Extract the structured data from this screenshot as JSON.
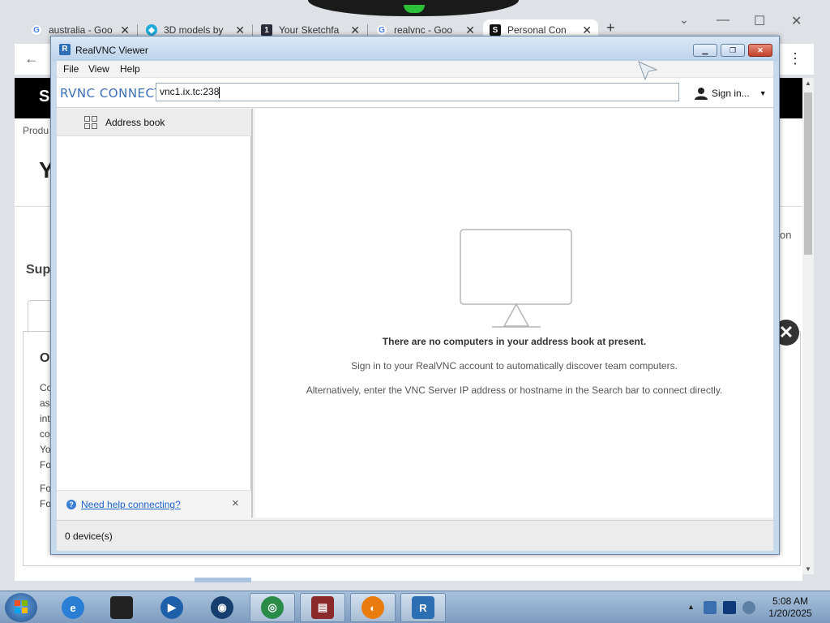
{
  "browser": {
    "tabs": [
      {
        "title": "australia - Goo",
        "icon": "google-icon",
        "active": false
      },
      {
        "title": "3D models by",
        "icon": "sketchfab-icon",
        "active": false
      },
      {
        "title": "Your Sketchfa",
        "icon": "sketchfab-numbered-icon",
        "active": false
      },
      {
        "title": "realvnc - Goo",
        "icon": "google-icon",
        "active": false
      },
      {
        "title": "Personal Con",
        "icon": "s-logo-icon",
        "active": true
      }
    ],
    "tab_badge_3": "1",
    "new_tab": "+",
    "page": {
      "brand_letter": "S",
      "products_fragment": "Produ",
      "support_fragment": "Sup",
      "right_fragment": "on",
      "card_heading_fragment": "O",
      "card_lines": [
        "Co",
        "as",
        "int",
        "co",
        "Yo",
        "Fo",
        "",
        "Fo",
        "Fo"
      ]
    }
  },
  "vnc": {
    "window_title": "RealVNC Viewer",
    "app_icon_letter": "R",
    "menu": [
      "File",
      "View",
      "Help"
    ],
    "logo": "RVNC CONNECT",
    "search_value": "vnc1.ix.tc:238",
    "sign_in": "Sign in...",
    "sidebar": {
      "address_book": "Address book",
      "help_link": "Need help connecting?",
      "help_close": "×"
    },
    "empty_state": {
      "heading": "There are no computers in your address book at present.",
      "line1": "Sign in to your RealVNC account to automatically discover team computers.",
      "line2": "Alternatively, enter the VNC Server IP address or hostname in the Search bar to connect directly."
    },
    "status": "0 device(s)"
  },
  "taskbar": {
    "items": [
      {
        "name": "internet-explorer-icon",
        "color": "#2a7fd4"
      },
      {
        "name": "terminal-box-icon",
        "color": "#222222"
      },
      {
        "name": "media-player-icon",
        "color": "#1d5fa8"
      },
      {
        "name": "globe-icon",
        "color": "#163e6e"
      },
      {
        "name": "browser-app-icon",
        "color": "#2b8c4a"
      },
      {
        "name": "winrar-icon",
        "color": "#8a2a2a"
      },
      {
        "name": "blender-icon",
        "color": "#e87d0d"
      },
      {
        "name": "realvnc-icon",
        "color": "#2d6fb3"
      }
    ],
    "clock_time": "5:08 AM",
    "clock_date": "1/20/2025"
  }
}
